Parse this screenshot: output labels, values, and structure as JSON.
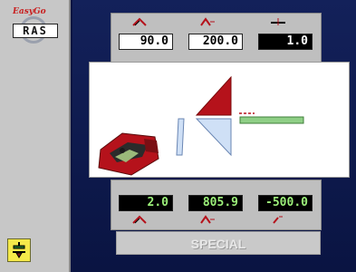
{
  "logo": {
    "script": "EasyGo",
    "text": "RAS"
  },
  "sidebar": {
    "tool_icon": "press-tool-icon"
  },
  "top_fields": [
    {
      "value": "90.0",
      "icon": "angle-icon"
    },
    {
      "value": "200.0",
      "icon": "angle-offset-icon"
    },
    {
      "value": "1.0",
      "icon": "thickness-icon"
    }
  ],
  "bottom_fields": [
    {
      "value": "2.0",
      "icon": "angle-icon"
    },
    {
      "value": "805.9",
      "icon": "angle-offset-icon"
    },
    {
      "value": "-500.0",
      "icon": "backgauge-icon"
    }
  ],
  "special_button": {
    "label": "SPECIAL"
  },
  "colors": {
    "accent_red": "#b5121b",
    "light_blue": "#cfe0f6",
    "green": "#8fcf86",
    "screen_blue": "#0a1442"
  }
}
